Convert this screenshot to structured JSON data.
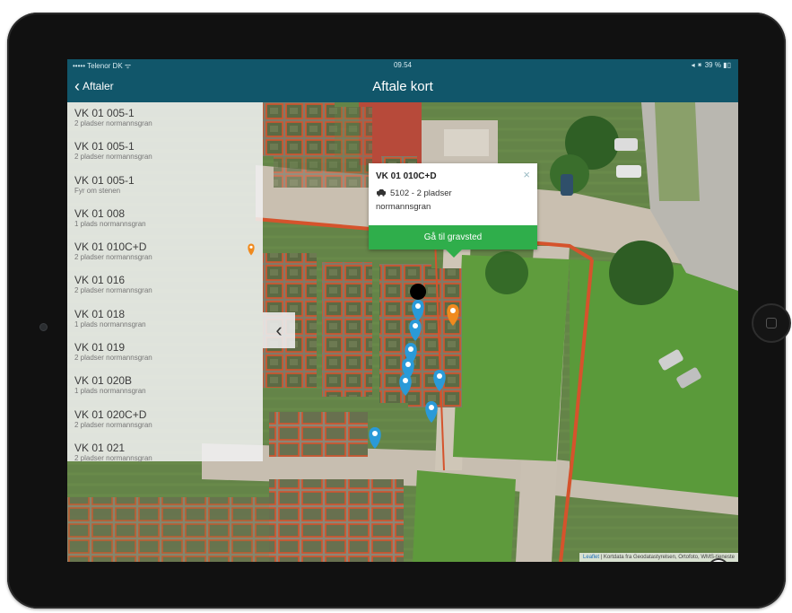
{
  "status_bar": {
    "carrier": "••••• Telenor DK ᯤ",
    "time": "09.54",
    "battery": "◂ ⁕ 39 % ▮▯"
  },
  "nav": {
    "back_label": "Aftaler",
    "title": "Aftale kort"
  },
  "sidebar": {
    "items": [
      {
        "title": "VK 01  005-1",
        "subtitle": "2 pladser normannsgran"
      },
      {
        "title": "VK 01  005-1",
        "subtitle": "2 pladser normannsgran"
      },
      {
        "title": "VK 01  005-1",
        "subtitle": "Fyr om stenen"
      },
      {
        "title": "VK 01  008",
        "subtitle": "1 plads normannsgran"
      },
      {
        "title": "VK 01  010C+D",
        "subtitle": "2 pladser normannsgran"
      },
      {
        "title": "VK 01  016",
        "subtitle": "2 pladser normannsgran"
      },
      {
        "title": "VK 01  018",
        "subtitle": "1 plads normannsgran"
      },
      {
        "title": "VK 01  019",
        "subtitle": "2 pladser normannsgran"
      },
      {
        "title": "VK 01  020B",
        "subtitle": "1 plads normannsgran"
      },
      {
        "title": "VK 01  020C+D",
        "subtitle": "2 pladser normannsgran"
      },
      {
        "title": "VK 01  021",
        "subtitle": "2 pladser normannsgran"
      }
    ]
  },
  "popup": {
    "title": "VK 01 010C+D",
    "line1": "5102 - 2 pladser",
    "line2": "normannsgran",
    "close": "×",
    "button": "Gå til gravsted"
  },
  "map": {
    "attribution_link": "Leaflet",
    "attribution_text": "| Kortdata fra Geodatastyrelsen, Ortofoto, WMS-tjeneste",
    "marker_colors": {
      "default": "#2a9ad8",
      "selected": "#f08a1e"
    },
    "collapse_glyph": "‹"
  },
  "colors": {
    "header": "#11566a",
    "accent_green": "#2fae4b",
    "plot_border": "#d5532c"
  }
}
